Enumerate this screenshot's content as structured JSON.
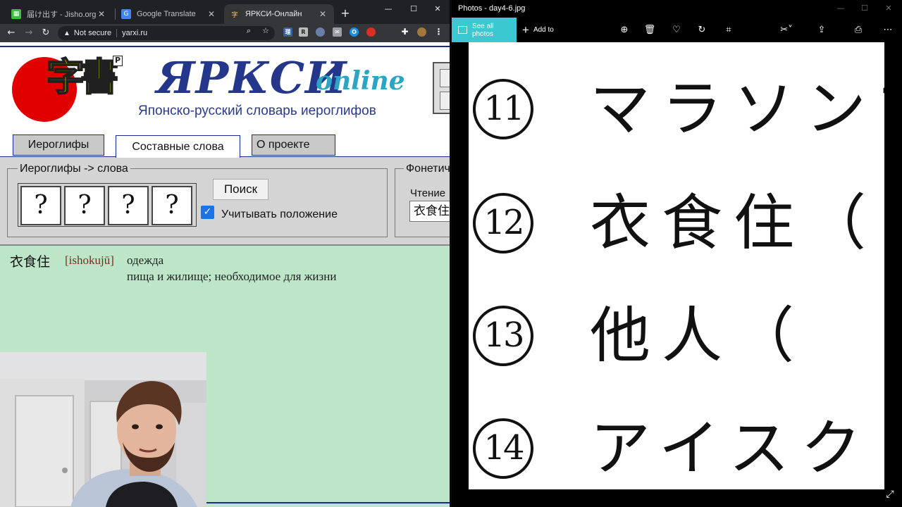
{
  "browser": {
    "tabs": [
      {
        "title": "届け出す - Jisho.org",
        "favicon": "jisho-icon",
        "color": "#3dbe3d"
      },
      {
        "title": "Google Translate",
        "favicon": "translate-icon",
        "color": "#4285f4"
      },
      {
        "title": "ЯРКСИ-Онлайн",
        "favicon": "yarxi-icon",
        "color": "#f7e600"
      }
    ],
    "close_glyph": "✕",
    "new_tab_glyph": "+",
    "window_controls": [
      "—",
      "☐",
      "✕"
    ],
    "security_label": "Not secure",
    "url": "yarxi.ru"
  },
  "page": {
    "logo_kanji": "字書",
    "logo_badge": "P",
    "logo_title": "ЯРКСИ",
    "logo_online": "online",
    "logo_subtitle": "Японско-русский словарь иероглифов",
    "tabs": {
      "kanji": "Иероглифы",
      "words": "Составные слова",
      "about": "О проекте"
    },
    "kanji_search": {
      "legend": "Иероглифы -> слова",
      "boxes": [
        "?",
        "?",
        "?",
        "?"
      ],
      "search_label": "Поиск",
      "position_label": "Учитывать положение",
      "position_checked": true
    },
    "phonetic_search": {
      "legend": "Фонетический поиск",
      "reading_label": "Чтение",
      "reading_value": "衣食住"
    },
    "result": {
      "word": "衣食住",
      "reading": "[ishokujū]",
      "meaning_1": "одежда",
      "meaning_2": "пища и жилище; необходимое для жизни"
    }
  },
  "photos": {
    "title": "Photos - day4-6.jpg",
    "window_controls": [
      "—",
      "☐",
      "✕"
    ],
    "see_all": "See all photos",
    "add_to": "Add to",
    "accent": "#3cc8d0",
    "image_rows": [
      {
        "num": "11",
        "text": "マラソンプ"
      },
      {
        "num": "12",
        "text": "衣食住（"
      },
      {
        "num": "13",
        "text": "他人（"
      },
      {
        "num": "14",
        "text": "アイスクリ"
      }
    ]
  }
}
